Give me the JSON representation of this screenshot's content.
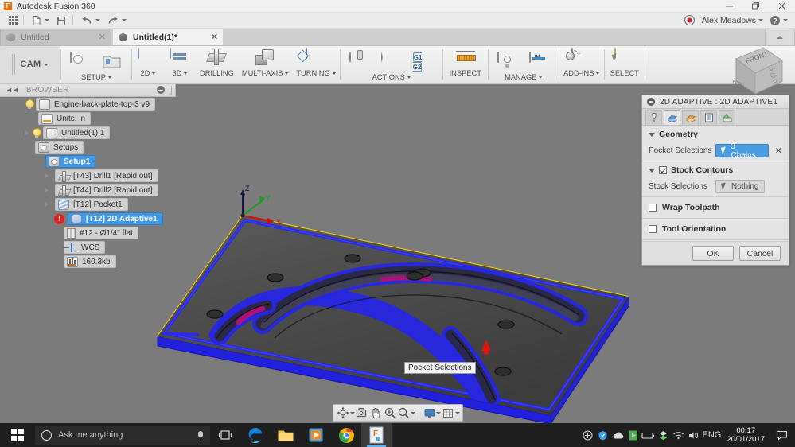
{
  "window": {
    "app_title": "Autodesk Fusion 360",
    "logo_letter": "F",
    "minimize": "—",
    "restore": "❐",
    "close": "✕"
  },
  "quick_access": {
    "items": [
      {
        "name": "app-grid",
        "icon": "grid-icon",
        "caret": false
      },
      {
        "name": "new-document",
        "icon": "file-icon",
        "caret": true
      },
      {
        "name": "save",
        "icon": "save-icon",
        "caret": false
      },
      {
        "name": "undo",
        "icon": "undo-icon",
        "caret": true
      },
      {
        "name": "redo",
        "icon": "redo-icon",
        "caret": true
      }
    ]
  },
  "account": {
    "name": "Alex Meadows",
    "record_icon": "record-icon",
    "help_icon": "help-icon"
  },
  "doc_tabs": [
    {
      "label": "Untitled",
      "active": false,
      "close": "✕"
    },
    {
      "label": "Untitled(1)*",
      "active": true,
      "close": "✕"
    }
  ],
  "workspace": {
    "label": "CAM"
  },
  "ribbon": {
    "groups": [
      {
        "name": "setup",
        "label": "SETUP",
        "caret": true,
        "buttons": [
          {
            "name": "setup-button",
            "icon": "setup-icon"
          },
          {
            "name": "new-folder-button",
            "icon": "folder-icon"
          }
        ]
      },
      {
        "name": "twod",
        "label": "2D",
        "caret": true,
        "buttons": [
          {
            "name": "2d-button",
            "icon": "2d-icon"
          }
        ]
      },
      {
        "name": "threed",
        "label": "3D",
        "caret": true,
        "buttons": [
          {
            "name": "3d-button",
            "icon": "3d-icon"
          }
        ]
      },
      {
        "name": "drilling",
        "label": "DRILLING",
        "caret": false,
        "buttons": [
          {
            "name": "drilling-button",
            "icon": "drill-icon"
          }
        ]
      },
      {
        "name": "multi-axis",
        "label": "MULTI-AXIS",
        "caret": true,
        "buttons": [
          {
            "name": "multi-axis-button",
            "icon": "multi-axis-icon"
          }
        ]
      },
      {
        "name": "turning",
        "label": "TURNING",
        "caret": true,
        "buttons": [
          {
            "name": "turning-button",
            "icon": "turning-icon"
          }
        ]
      },
      {
        "name": "actions",
        "label": "ACTIONS",
        "caret": true,
        "buttons": [
          {
            "name": "simulate-button",
            "icon": "simulate-icon"
          },
          {
            "name": "post-process-button",
            "icon": "post-icon"
          },
          {
            "name": "g-code-button",
            "icon": "g1g2-icon",
            "text": "G1 G2"
          }
        ]
      },
      {
        "name": "inspect",
        "label": "INSPECT",
        "caret": false,
        "buttons": [
          {
            "name": "inspect-button",
            "icon": "measure-icon"
          }
        ]
      },
      {
        "name": "manage",
        "label": "MANAGE",
        "caret": true,
        "buttons": [
          {
            "name": "tool-library-button",
            "icon": "tool-library-icon"
          },
          {
            "name": "machining-time-button",
            "icon": "percent-icon"
          }
        ]
      },
      {
        "name": "add-ins",
        "label": "ADD-INS",
        "caret": true,
        "buttons": [
          {
            "name": "add-ins-button",
            "icon": "script-icon"
          }
        ]
      },
      {
        "name": "select",
        "label": "SELECT",
        "caret": false,
        "buttons": [
          {
            "name": "select-button",
            "icon": "select-icon"
          }
        ]
      }
    ]
  },
  "browser": {
    "title": "BROWSER",
    "collapse_icon": "collapse-arrows-icon",
    "menu_icon": "browser-menu-icon",
    "tree": [
      {
        "label": "Engine-back-plate-top-3 v9",
        "indent": 0,
        "expander": "down",
        "bulb": true,
        "icon": "component-icon",
        "selected": false
      },
      {
        "label": "Units: in",
        "indent": 1,
        "expander": "none",
        "bulb": false,
        "icon": "units-icon",
        "selected": false
      },
      {
        "label": "Untitled(1):1",
        "indent": 1,
        "expander": "right",
        "bulb": true,
        "icon": "body-icon",
        "selected": false
      },
      {
        "label": "Setups",
        "indent": 1,
        "expander": "down",
        "bulb": false,
        "icon": "setups-icon",
        "selected": false
      },
      {
        "label": "Setup1",
        "indent": 2,
        "expander": "down",
        "bulb": false,
        "icon": "setup-icon",
        "selected": true
      },
      {
        "label": "[T43] Drill1 [Rapid out]",
        "indent": 3,
        "expander": "right",
        "bulb": false,
        "icon": "drill-op-icon",
        "selected": false
      },
      {
        "label": "[T44] Drill2 [Rapid out]",
        "indent": 3,
        "expander": "right",
        "bulb": false,
        "icon": "drill-op-icon",
        "selected": false
      },
      {
        "label": "[T12] Pocket1",
        "indent": 3,
        "expander": "right",
        "bulb": false,
        "icon": "pocket-op-icon",
        "selected": false
      },
      {
        "label": "[T12] 2D Adaptive1",
        "indent": 3,
        "expander": "down",
        "bulb": false,
        "icon": "adaptive-op-icon",
        "selected": true,
        "error": true
      },
      {
        "label": "#12 - Ø1/4\" flat",
        "indent": 4,
        "expander": "none",
        "bulb": false,
        "icon": "tool-icon",
        "selected": false
      },
      {
        "label": "WCS",
        "indent": 4,
        "expander": "none",
        "bulb": false,
        "icon": "wcs-icon",
        "selected": false
      },
      {
        "label": "160.3kb",
        "indent": 4,
        "expander": "none",
        "bulb": false,
        "icon": "nc-file-icon",
        "selected": false
      }
    ]
  },
  "viewport": {
    "tooltip": "Pocket Selections",
    "origin_axes": [
      {
        "label": "Z",
        "color": "#1a1a6e"
      },
      {
        "label": "Y",
        "color": "#18a018"
      },
      {
        "label": "X",
        "color": "#d01010"
      }
    ],
    "colors": {
      "background": "#7b7b7b",
      "part_top": "#515151",
      "part_side": "#3b3b3b",
      "stock_outline": "#ffd400",
      "selected_chain": "#2828e8",
      "highlight": "#c01070",
      "arrow": "#e01010"
    },
    "viewcube": {
      "faces": [
        "FRONT",
        "BOTTOM",
        "RIGHT"
      ]
    },
    "nav_buttons": [
      {
        "name": "orbit-button",
        "icon": "orbit-icon",
        "caret": true
      },
      {
        "name": "look-at-button",
        "icon": "look-at-icon",
        "caret": false
      },
      {
        "name": "pan-button",
        "icon": "pan-hand-icon",
        "caret": false
      },
      {
        "name": "zoom-button",
        "icon": "zoom-icon",
        "caret": false
      },
      {
        "name": "fit-button",
        "icon": "fit-icon",
        "caret": true
      },
      {
        "name": "display-settings-button",
        "icon": "display-icon",
        "caret": true
      },
      {
        "name": "grid-snaps-button",
        "icon": "grid-icon",
        "caret": true
      }
    ]
  },
  "dialog": {
    "title": "2D ADAPTIVE : 2D ADAPTIVE1",
    "collapse_icon": "dialog-collapse-icon",
    "tabs": [
      {
        "name": "tool-tab",
        "icon": "endmill-icon",
        "active": false
      },
      {
        "name": "geometry-tab",
        "icon": "geometry-icon",
        "active": true
      },
      {
        "name": "heights-tab",
        "icon": "heights-icon",
        "active": false
      },
      {
        "name": "passes-tab",
        "icon": "passes-icon",
        "active": false
      },
      {
        "name": "linking-tab",
        "icon": "linking-icon",
        "active": false
      }
    ],
    "geometry": {
      "section_label": "Geometry",
      "pocket_label": "Pocket Selections",
      "pocket_value": "3 Chains",
      "clear_icon": "✕"
    },
    "stock_contours": {
      "section_label": "Stock Contours",
      "checked": true,
      "stock_label": "Stock Selections",
      "stock_value": "Nothing"
    },
    "wrap_toolpath": {
      "label": "Wrap Toolpath",
      "checked": false
    },
    "tool_orientation": {
      "label": "Tool Orientation",
      "checked": false
    },
    "ok_label": "OK",
    "cancel_label": "Cancel"
  },
  "taskbar": {
    "start_icon": "windows-start-icon",
    "search_placeholder": "Ask me anything",
    "cortana_icon": "cortana-circle-icon",
    "mic_icon": "microphone-icon",
    "apps": [
      {
        "name": "task-view-button",
        "icon": "task-view-icon",
        "active": false
      },
      {
        "name": "edge-button",
        "icon": "edge-icon",
        "active": false
      },
      {
        "name": "file-explorer-button",
        "icon": "folder-icon",
        "active": false
      },
      {
        "name": "movies-tv-button",
        "icon": "media-play-icon",
        "active": false
      },
      {
        "name": "chrome-button",
        "icon": "chrome-icon",
        "active": false
      },
      {
        "name": "fusion360-button",
        "icon": "fusion-icon",
        "active": true
      }
    ],
    "tray_icons": [
      "hidden-icons-icon",
      "security-shield-icon",
      "onedrive-cloud-icon",
      "fusion-tray-icon",
      "battery-icon",
      "dropbox-icon",
      "wifi-icon",
      "volume-icon"
    ],
    "language": "ENG",
    "clock_time": "00:17",
    "clock_date": "20/01/2017",
    "action_center_icon": "action-center-icon"
  }
}
